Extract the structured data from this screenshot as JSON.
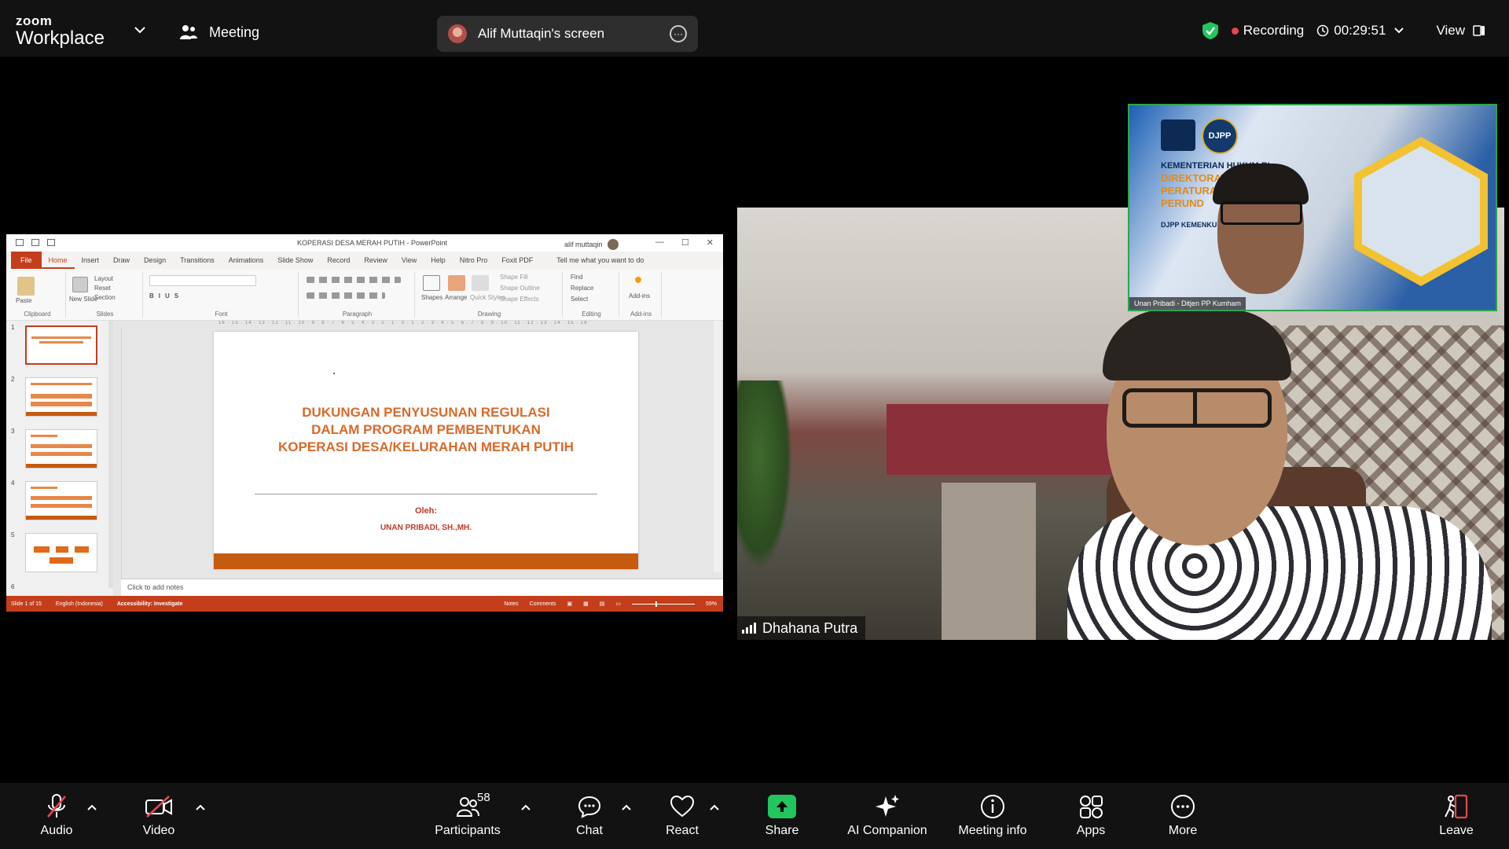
{
  "app": {
    "brand_top": "zoom",
    "brand_bottom": "Workplace",
    "meeting_label": "Meeting"
  },
  "share_pill": {
    "label": "Alif Muttaqin's screen"
  },
  "status": {
    "recording_label": "Recording",
    "timer": "00:29:51",
    "view_label": "View"
  },
  "powerpoint": {
    "window_title": "KOPERASI DESA MERAH PUTIH  -  PowerPoint",
    "user": "alif muttaqin",
    "tabs": [
      "File",
      "Home",
      "Insert",
      "Draw",
      "Design",
      "Transitions",
      "Animations",
      "Slide Show",
      "Record",
      "Review",
      "View",
      "Help",
      "Nitro Pro",
      "Foxit PDF"
    ],
    "tell_me": "Tell me what you want to do",
    "ribbon_groups": [
      "Clipboard",
      "Slides",
      "Font",
      "Paragraph",
      "Drawing",
      "Editing",
      "Add-ins"
    ],
    "ribbon_items": {
      "paste": "Paste",
      "new_slide": "New Slide",
      "layout": "Layout",
      "reset": "Reset",
      "section": "Section",
      "shapes": "Shapes",
      "arrange": "Arrange",
      "quick_styles": "Quick Styles",
      "shape_fill": "Shape Fill",
      "shape_outline": "Shape Outline",
      "shape_effects": "Shape Effects",
      "find": "Find",
      "replace": "Replace",
      "select": "Select",
      "add_ins": "Add-ins"
    },
    "thumb_numbers": [
      "1",
      "2",
      "3",
      "4",
      "5",
      "6"
    ],
    "ruler": "16 · 15 · 14 · 13 · 12 · 11 · 10 · 9 · 8 · 7 · 6 · 5 · 4 · 3 · 2 · 1 · 0 · 1 · 2 · 3 · 4 · 5 · 6 · 7 · 8 · 9 · 10 · 11 · 12 · 13 · 14 · 15 · 16",
    "slide": {
      "title_line1": "DUKUNGAN PENYUSUNAN REGULASI",
      "title_line2": "DALAM PROGRAM PEMBENTUKAN",
      "title_line3": "KOPERASI DESA/KELURAHAN MERAH PUTIH",
      "oleh": "Oleh:",
      "author": "UNAN PRIBADI, SH.,MH."
    },
    "notes_placeholder": "Click to add notes",
    "status_bar": {
      "slide_count": "Slide 1 of 15",
      "language": "English (Indonesia)",
      "accessibility": "Accessibility: Investigate",
      "notes": "Notes",
      "comments": "Comments",
      "zoom": "59%"
    }
  },
  "video_main": {
    "name": "Dhahana Putra"
  },
  "video_pip": {
    "logo_text": "DJPP",
    "line1": "KEMENTERIAN HUKUM RI",
    "line2": "DIREKTORAT",
    "line3": "PERATURAN",
    "line4": "PERUND",
    "line5": "DJPP KEMENKU",
    "name": "Unan Pribadi - Ditjen PP Kumham"
  },
  "toolbar": {
    "audio": "Audio",
    "video": "Video",
    "participants": "Participants",
    "participants_count": "58",
    "chat": "Chat",
    "react": "React",
    "share": "Share",
    "ai_companion": "AI Companion",
    "meeting_info": "Meeting info",
    "apps": "Apps",
    "more": "More",
    "leave": "Leave"
  },
  "colors": {
    "accent_green": "#22c55e",
    "recording_red": "#e5484d",
    "leave_red": "#e5484d",
    "ppt_red": "#c43e1c",
    "slide_title_orange": "#d9692a"
  }
}
